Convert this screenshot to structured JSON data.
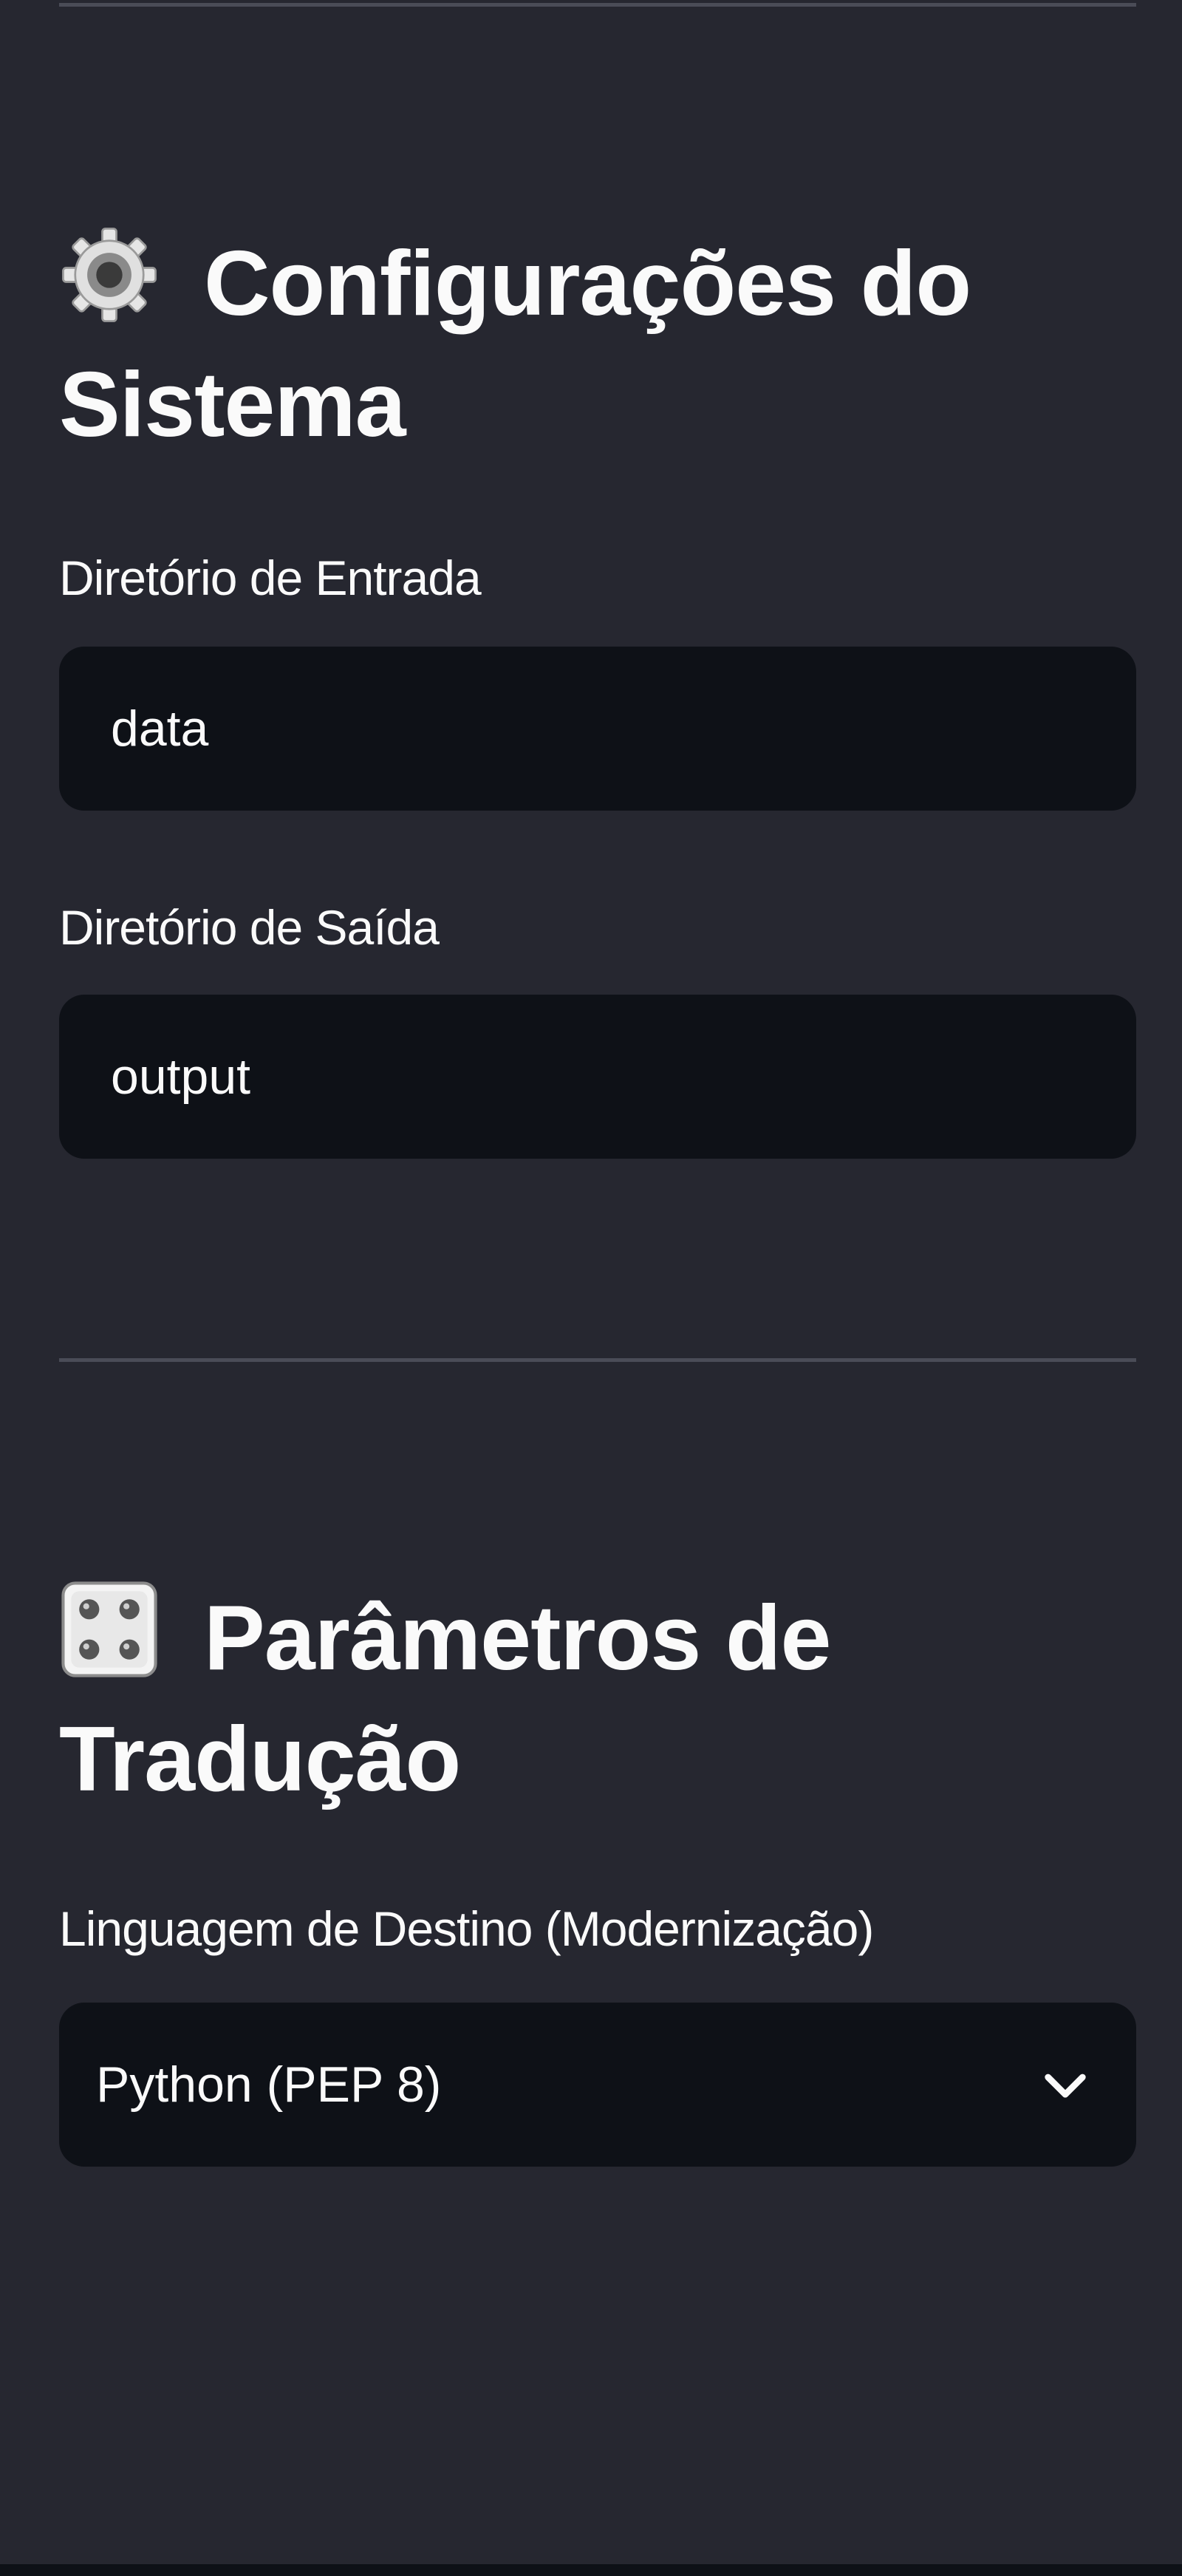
{
  "sidebar": {
    "system_settings": {
      "icon": "gear-icon",
      "title": "Configurações do Sistema",
      "input_dir": {
        "label": "Diretório de Entrada",
        "value": "data"
      },
      "output_dir": {
        "label": "Diretório de Saída",
        "value": "output"
      }
    },
    "translation_params": {
      "icon": "dice-icon",
      "title": "Parâmetros de Tradução",
      "target_language": {
        "label": "Linguagem de Destino (Modernização)",
        "selected": "Python (PEP 8)",
        "dropdown_icon": "chevron-down-icon"
      }
    }
  },
  "colors": {
    "sidebar_background": "#262730",
    "input_background": "#0e1117",
    "text": "#fafafa",
    "divider": "#4a4c57"
  }
}
